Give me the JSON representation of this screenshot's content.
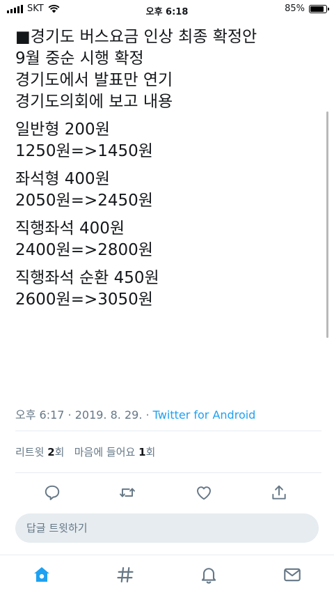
{
  "status_bar": {
    "carrier": "SKT",
    "time": "오후 6:18",
    "battery": "85%"
  },
  "tweet": {
    "blocks": [
      [
        "■경기도 버스요금 인상 최종 확정안",
        "9월 중순 시행 확정",
        "경기도에서 발표만 연기",
        "경기도의회에 보고 내용"
      ],
      [
        "일반형 200원",
        "1250원=>1450원"
      ],
      [
        "좌석형 400원",
        "2050원=>2450원"
      ],
      [
        "직행좌석 400원",
        "2400원=>2800원"
      ],
      [
        "직행좌석 순환 450원",
        "2600원=>3050원"
      ]
    ],
    "timestamp": "오후 6:17 · 2019. 8. 29. · ",
    "source": "Twitter for Android"
  },
  "stats": {
    "retweet_label": "리트윗",
    "retweet_count": "2",
    "count_suffix": "회",
    "like_label": "마음에 들어요",
    "like_count": "1"
  },
  "actions": [
    "reply-icon",
    "retweet-icon",
    "like-icon",
    "share-icon"
  ],
  "reply_box": {
    "placeholder": "답글 트윗하기"
  },
  "tabs": [
    "home-icon",
    "explore-icon",
    "notifications-icon",
    "messages-icon"
  ],
  "colors": {
    "accent": "#1da1f2",
    "muted": "#657786",
    "text": "#14171a",
    "divider": "#e6ecf0"
  }
}
